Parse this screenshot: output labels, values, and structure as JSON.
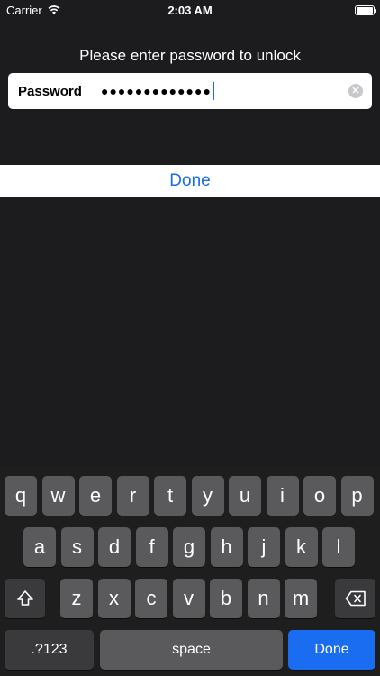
{
  "status_bar": {
    "carrier": "Carrier",
    "time": "2:03 AM"
  },
  "prompt": "Please enter password to unlock",
  "password_field": {
    "label": "Password",
    "value": "●●●●●●●●●●●●●"
  },
  "done_bar_label": "Done",
  "keyboard": {
    "row1": [
      "q",
      "w",
      "e",
      "r",
      "t",
      "y",
      "u",
      "i",
      "o",
      "p"
    ],
    "row2": [
      "a",
      "s",
      "d",
      "f",
      "g",
      "h",
      "j",
      "k",
      "l"
    ],
    "row3": [
      "z",
      "x",
      "c",
      "v",
      "b",
      "n",
      "m"
    ],
    "numbers_label": ".?123",
    "space_label": "space",
    "return_label": "Done"
  },
  "colors": {
    "accent": "#1a6cf0",
    "background": "#1c1c1e"
  }
}
